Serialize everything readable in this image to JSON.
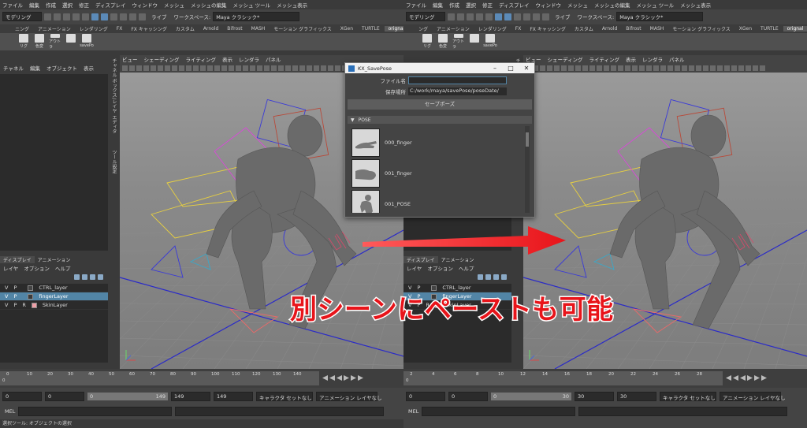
{
  "menu": [
    "ファイル",
    "編集",
    "作成",
    "選択",
    "修正",
    "ディスプレイ",
    "ウィンドウ",
    "メッシュ",
    "メッシュの編集",
    "メッシュ ツール",
    "メッシュ表示"
  ],
  "workspace_label": "ワークスペース:",
  "workspace_value": "Maya クラシック*",
  "mode_dropdown": "モデリング",
  "live_label": "ライブ",
  "shelf_tabs_left": [
    "ニング",
    "アニメーション",
    "レンダリング",
    "FX",
    "FX キャッシング",
    "カスタム",
    "Arnold",
    "Bifrost",
    "MASH",
    "モーション グラフィックス",
    "XGen",
    "TURTLE",
    "orignal"
  ],
  "shelf_tabs_right": [
    "ング",
    "アニメーション",
    "レンダリング",
    "FX",
    "FX キャッシング",
    "カスタム",
    "Arnold",
    "Bifrost",
    "MASH",
    "モーション グラフィックス",
    "XGen",
    "TURTLE",
    "orignal"
  ],
  "shelf_active": "orignal",
  "shelf_buttons": [
    "リグ",
    "色変",
    "アウトラ",
    "",
    "savePo"
  ],
  "outliner_menu": [
    "チャネル",
    "編集",
    "オブジェクト",
    "表示"
  ],
  "vertical_tabs": [
    "チャネル ボックス/レイヤ エディタ",
    "ツール設定"
  ],
  "viewport_menu": [
    "ビュー",
    "シェーディング",
    "ライティング",
    "表示",
    "レンダラ",
    "パネル"
  ],
  "layer_tabs": [
    "ディスプレイ",
    "アニメーション"
  ],
  "layer_menu": [
    "レイヤ",
    "オプション",
    "ヘルプ"
  ],
  "layers": [
    {
      "v": "V",
      "p": "P",
      "r": "",
      "name": "CTRL_layer",
      "selected": false,
      "color": "#444444"
    },
    {
      "v": "V",
      "p": "P",
      "r": "",
      "name": "fingerLayer",
      "selected": true,
      "color": "#3a3a3a"
    },
    {
      "v": "V",
      "p": "P",
      "r": "R",
      "name": "SkinLayer",
      "selected": false,
      "color": "#f0a0a8"
    }
  ],
  "ruler_left": [
    "0",
    "10",
    "20",
    "30",
    "40",
    "50",
    "60",
    "70",
    "80",
    "90",
    "100",
    "110",
    "120",
    "130",
    "140"
  ],
  "ruler_right": [
    "2",
    "4",
    "6",
    "8",
    "10",
    "12",
    "14",
    "16",
    "18",
    "20",
    "22",
    "24",
    "26",
    "28"
  ],
  "current_frame": "0",
  "range_left": {
    "start": "0",
    "anim_start": "0",
    "bar_start": "0",
    "bar_end": "149",
    "end": "149",
    "anim_end": "149"
  },
  "range_right": {
    "start": "0",
    "anim_start": "0",
    "bar_start": "0",
    "bar_end": "30",
    "end": "30",
    "anim_end": "30"
  },
  "character_set": "キャラクタ セットなし",
  "anim_layer": "アニメーション レイヤなし",
  "mel_label": "MEL",
  "help_line": "選択ツール: オブジェクトの選択",
  "dialog": {
    "title": "KX_SavePose",
    "filename_label": "ファイル名",
    "filename_value": "",
    "path_label": "保存場所",
    "path_value": "C:/work/maya/savePose/poseDate/",
    "save_button": "セーブポーズ",
    "frame_label": "POSE",
    "poses": [
      "000_finger",
      "001_finger",
      "001_POSE"
    ]
  },
  "caption": "別シーンにペーストも可能",
  "accent_colors": {
    "selection": "#5285a6",
    "arrow": "#e8141a"
  }
}
